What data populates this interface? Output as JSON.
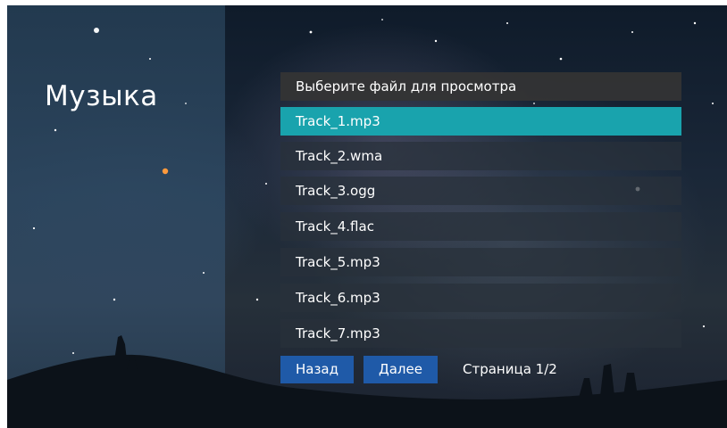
{
  "title": "Музыка",
  "list": {
    "header": "Выберите файл для просмотра",
    "items": [
      {
        "label": "Track_1.mp3",
        "selected": true
      },
      {
        "label": "Track_2.wma",
        "selected": false
      },
      {
        "label": "Track_3.ogg",
        "selected": false
      },
      {
        "label": "Track_4.flac",
        "selected": false
      },
      {
        "label": "Track_5.mp3",
        "selected": false
      },
      {
        "label": "Track_6.mp3",
        "selected": false
      },
      {
        "label": "Track_7.mp3",
        "selected": false
      }
    ]
  },
  "footer": {
    "back_label": "Назад",
    "next_label": "Далее",
    "page_text": "Страница 1/2"
  },
  "colors": {
    "selected_row": "#19a3ad",
    "button": "#1f5aa8",
    "row_background": "#282f3a",
    "header_background": "#343434"
  }
}
